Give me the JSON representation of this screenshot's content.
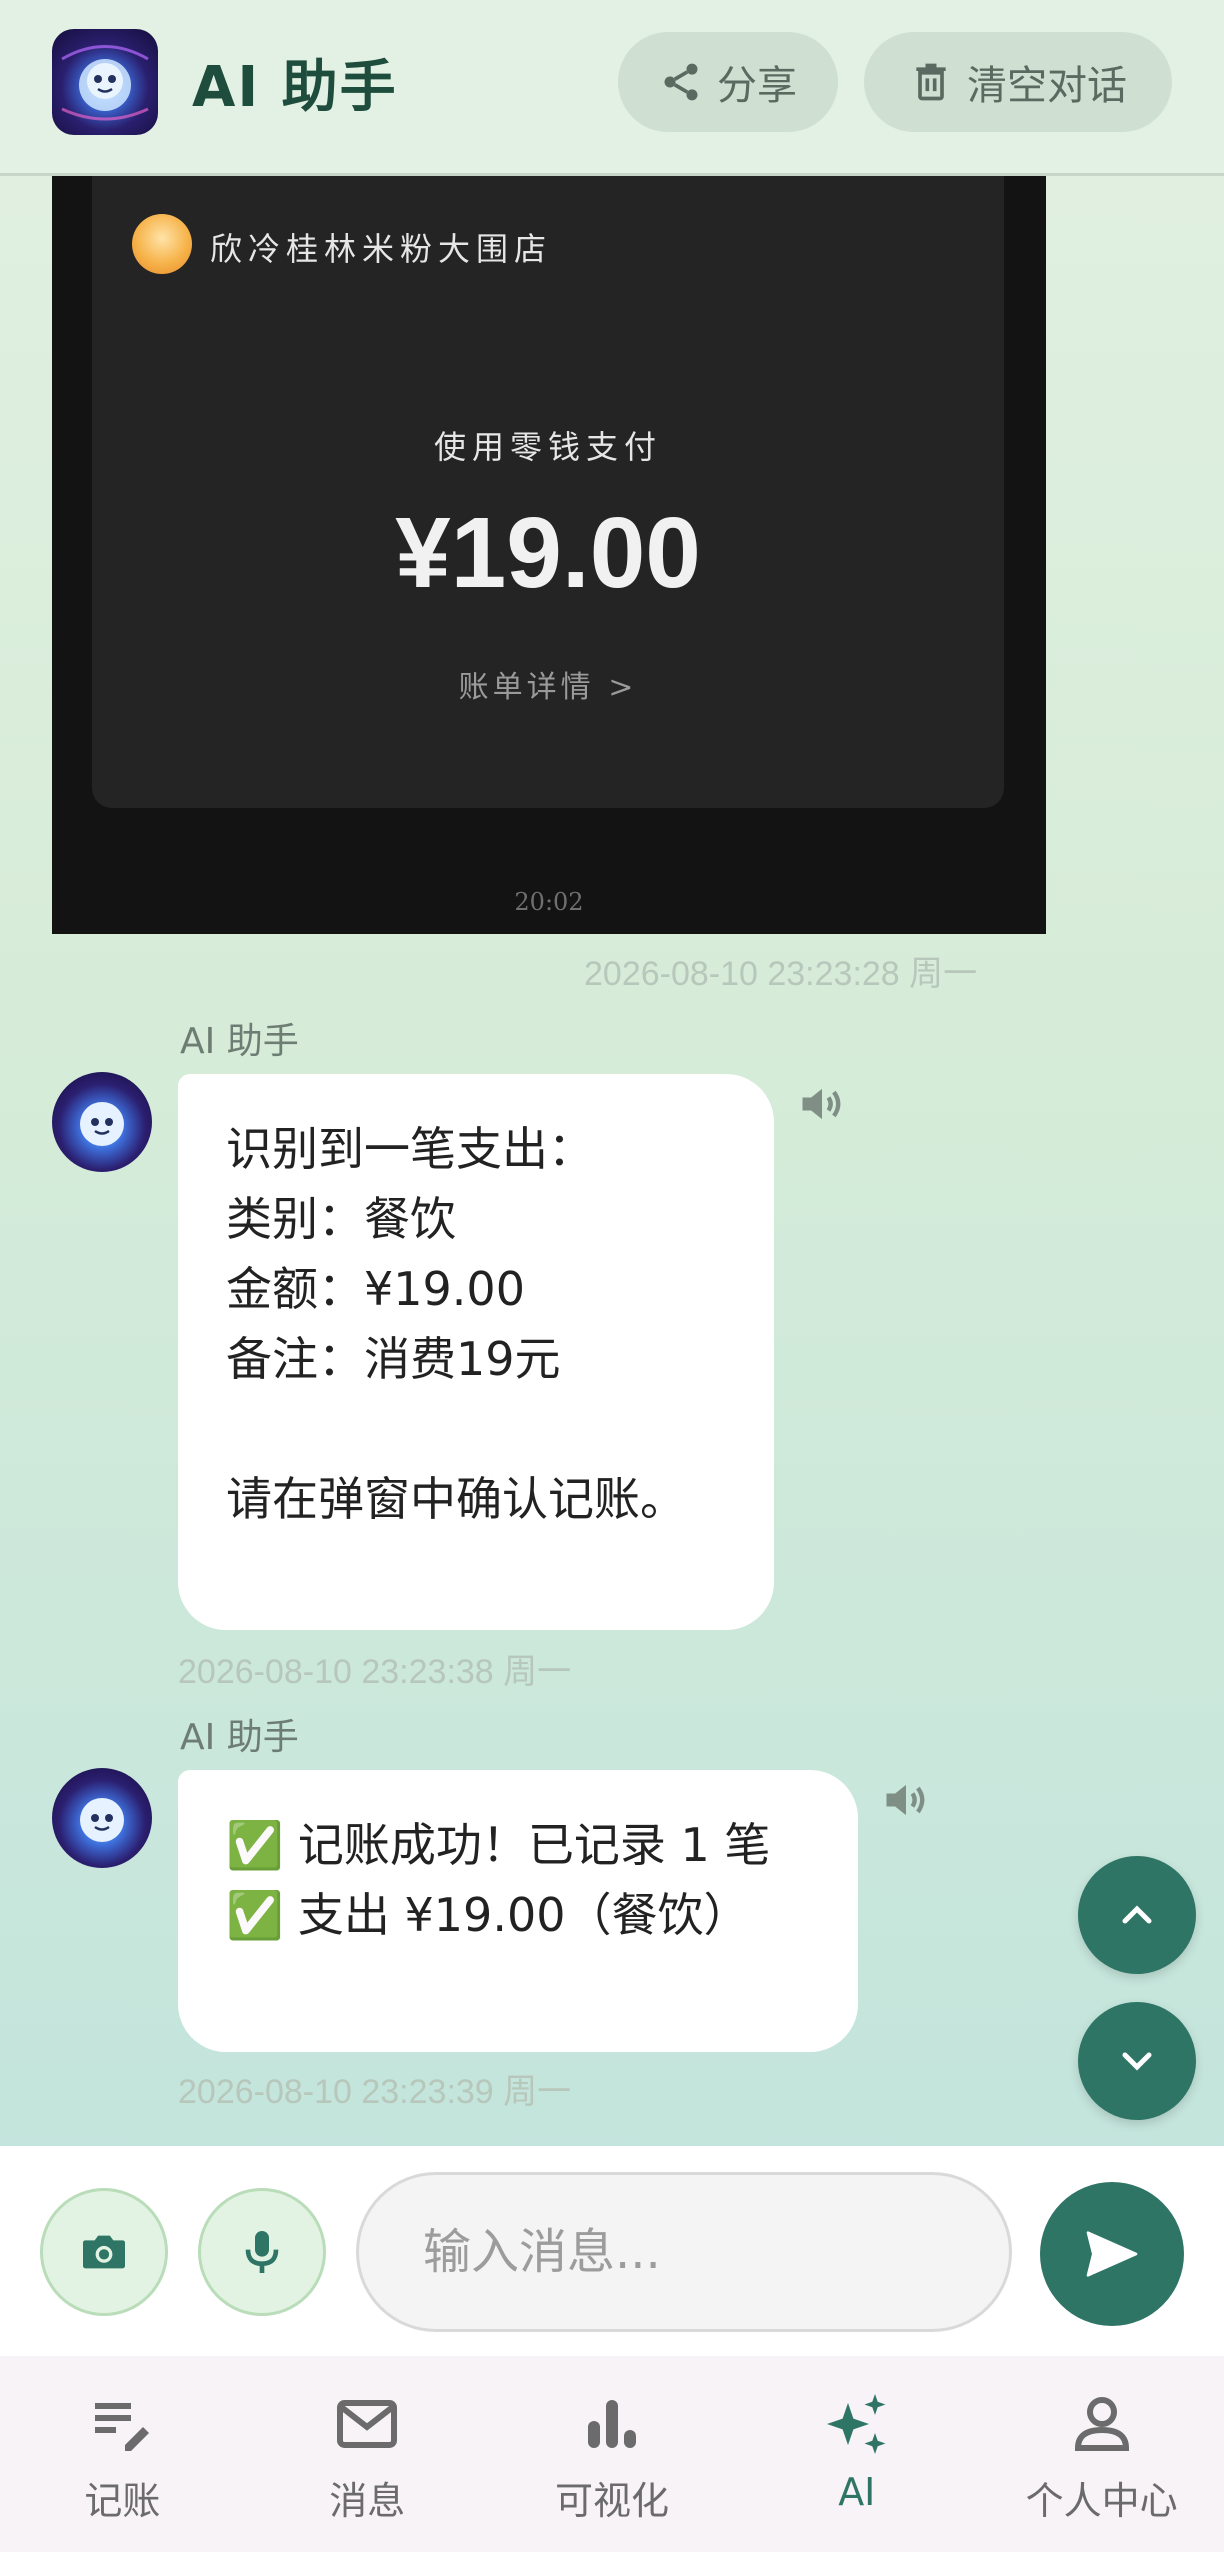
{
  "header": {
    "title": "AI 助手",
    "share_label": "分享",
    "clear_label": "清空对话"
  },
  "receipt_image": {
    "merchant": "欣冷桂林米粉大围店",
    "pay_method": "使用零钱支付",
    "amount": "¥19.00",
    "detail_link": "账单详情 >",
    "time": "20:02"
  },
  "messages": [
    {
      "timestamp": "2026-08-10 23:23:28 周一"
    },
    {
      "sender": "AI 助手",
      "lines": [
        "识别到一笔支出：",
        "类别：餐饮",
        "金额：¥19.00",
        "备注：消费19元",
        "",
        "请在弹窗中确认记账。"
      ],
      "timestamp": "2026-08-10 23:23:38 周一"
    },
    {
      "sender": "AI 助手",
      "lines": [
        "✅ 记账成功！已记录 1 笔",
        "✅ 支出 ¥19.00（餐饮）"
      ],
      "timestamp": "2026-08-10 23:23:39 周一"
    }
  ],
  "input": {
    "placeholder": "输入消息..."
  },
  "nav": [
    {
      "label": "记账",
      "icon": "edit-note-icon"
    },
    {
      "label": "消息",
      "icon": "mail-icon"
    },
    {
      "label": "可视化",
      "icon": "bar-chart-icon"
    },
    {
      "label": "AI",
      "icon": "sparkle-icon",
      "active": true
    },
    {
      "label": "个人中心",
      "icon": "person-icon"
    }
  ],
  "colors": {
    "accent": "#2f7566",
    "header_bg": "#e3f1e4",
    "title": "#1e4d3d"
  }
}
